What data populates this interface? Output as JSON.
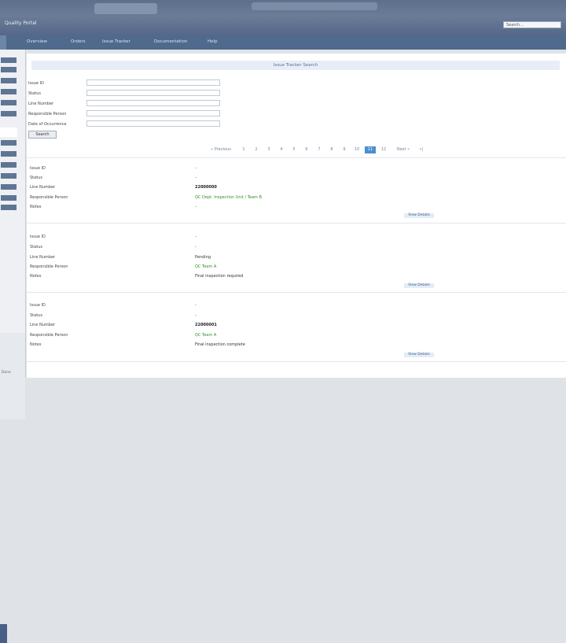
{
  "header": {
    "logo_text": "Quality Portal",
    "search_placeholder": "Search..."
  },
  "nav": {
    "items": [
      "Overview",
      "Orders",
      "Issue Tracker",
      "Documentation",
      "Help"
    ]
  },
  "main": {
    "page_title": "Issue Tracker Search",
    "form": {
      "fields": [
        {
          "label": "Issue ID"
        },
        {
          "label": "Status"
        },
        {
          "label": "Line Number"
        },
        {
          "label": "Responsible Person"
        },
        {
          "label": "Date of Occurrence"
        }
      ],
      "search_button": "Search"
    },
    "pager": {
      "prev_label": "« Previous",
      "pages": [
        "1",
        "2",
        "3",
        "4",
        "5",
        "6",
        "7",
        "8",
        "9",
        "10",
        "11",
        "12"
      ],
      "current_page": "11",
      "next_label": "Next »",
      "end": "»|"
    },
    "records": [
      {
        "fields": [
          {
            "label": "Issue ID",
            "value": "-"
          },
          {
            "label": "Status",
            "value": "-"
          },
          {
            "label": "Line Number",
            "value": "22000000"
          },
          {
            "label": "Responsible Person",
            "value": "QC Dept. Inspection Unit / Team B"
          },
          {
            "label": "Notes",
            "value": "-"
          }
        ],
        "detail_link": "View Details"
      },
      {
        "fields": [
          {
            "label": "Issue ID",
            "value": "-"
          },
          {
            "label": "Status",
            "value": "-"
          },
          {
            "label": "Line Number",
            "value": "Pending"
          },
          {
            "label": "Responsible Person",
            "value": "QC Team A"
          },
          {
            "label": "Notes",
            "value": "Final inspection required"
          }
        ],
        "detail_link": "View Details"
      },
      {
        "fields": [
          {
            "label": "Issue ID",
            "value": "-"
          },
          {
            "label": "Status",
            "value": "-"
          },
          {
            "label": "Line Number",
            "value": "22000001"
          },
          {
            "label": "Responsible Person",
            "value": "QC Team A"
          },
          {
            "label": "Notes",
            "value": "Final inspection complete"
          }
        ],
        "detail_link": "View Details"
      }
    ]
  },
  "sidebar": {
    "status_text": "Done"
  },
  "colors": {
    "accent": "#4b8fd0",
    "nav_bg": "#4f6a8c",
    "success": "#3a8c2f"
  }
}
